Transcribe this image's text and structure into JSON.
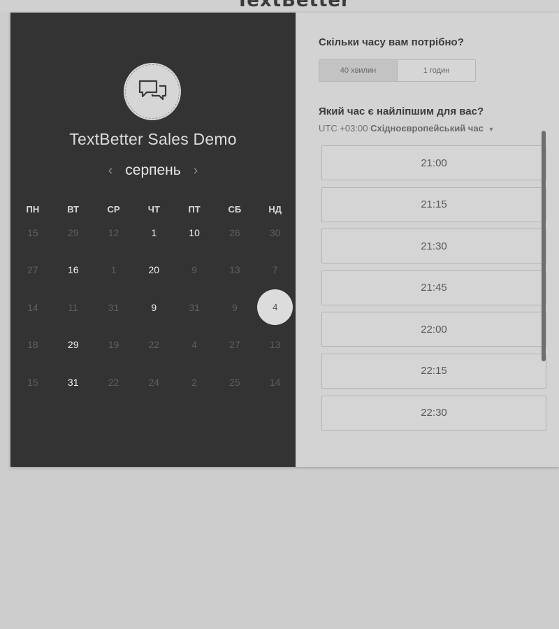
{
  "header": {
    "logo_text": "TextBetter"
  },
  "event": {
    "title": "TextBetter Sales Demo",
    "icon": "chat-bubbles-icon"
  },
  "calendar": {
    "month": "серпень",
    "prev_icon": "chevron-left-icon",
    "next_icon": "chevron-right-icon",
    "weekdays": [
      "ПН",
      "ВТ",
      "СР",
      "ЧТ",
      "ПТ",
      "СБ",
      "НД"
    ],
    "weeks": [
      [
        {
          "d": "15",
          "s": "muted"
        },
        {
          "d": "29",
          "s": "muted"
        },
        {
          "d": "12",
          "s": "muted"
        },
        {
          "d": "1",
          "s": "active"
        },
        {
          "d": "10",
          "s": "active"
        },
        {
          "d": "26",
          "s": "muted"
        },
        {
          "d": "30",
          "s": "muted"
        }
      ],
      [
        {
          "d": "27",
          "s": "muted"
        },
        {
          "d": "16",
          "s": "active"
        },
        {
          "d": "1",
          "s": "muted"
        },
        {
          "d": "20",
          "s": "active"
        },
        {
          "d": "9",
          "s": "muted"
        },
        {
          "d": "13",
          "s": "muted"
        },
        {
          "d": "7",
          "s": "muted"
        }
      ],
      [
        {
          "d": "14",
          "s": "muted"
        },
        {
          "d": "11",
          "s": "muted"
        },
        {
          "d": "31",
          "s": "muted"
        },
        {
          "d": "9",
          "s": "active"
        },
        {
          "d": "31",
          "s": "muted"
        },
        {
          "d": "9",
          "s": "muted"
        },
        {
          "d": "4",
          "s": "selected"
        }
      ],
      [
        {
          "d": "18",
          "s": "muted"
        },
        {
          "d": "29",
          "s": "active"
        },
        {
          "d": "19",
          "s": "muted"
        },
        {
          "d": "22",
          "s": "muted"
        },
        {
          "d": "4",
          "s": "muted"
        },
        {
          "d": "27",
          "s": "muted"
        },
        {
          "d": "13",
          "s": "muted"
        }
      ],
      [
        {
          "d": "15",
          "s": "muted"
        },
        {
          "d": "31",
          "s": "active"
        },
        {
          "d": "22",
          "s": "muted"
        },
        {
          "d": "24",
          "s": "muted"
        },
        {
          "d": "2",
          "s": "muted"
        },
        {
          "d": "25",
          "s": "muted"
        },
        {
          "d": "14",
          "s": "muted"
        }
      ]
    ]
  },
  "booking": {
    "duration_question": "Скільки часу вам потрібно?",
    "duration_options": [
      "40 хвилин",
      "1 годин"
    ],
    "duration_selected": "40 хвилин",
    "time_question": "Який час є найліпшим для вас?",
    "timezone_offset": "UTC +03:00",
    "timezone_name": "Східноєвропейський час",
    "timezone_caret_icon": "caret-down-icon",
    "slots": [
      "21:00",
      "21:15",
      "21:30",
      "21:45",
      "22:00",
      "22:15",
      "22:30",
      ""
    ]
  },
  "colors": {
    "left_panel_bg": "#333333",
    "page_bg": "#cccccc",
    "right_panel_bg": "#d3d3d3"
  }
}
